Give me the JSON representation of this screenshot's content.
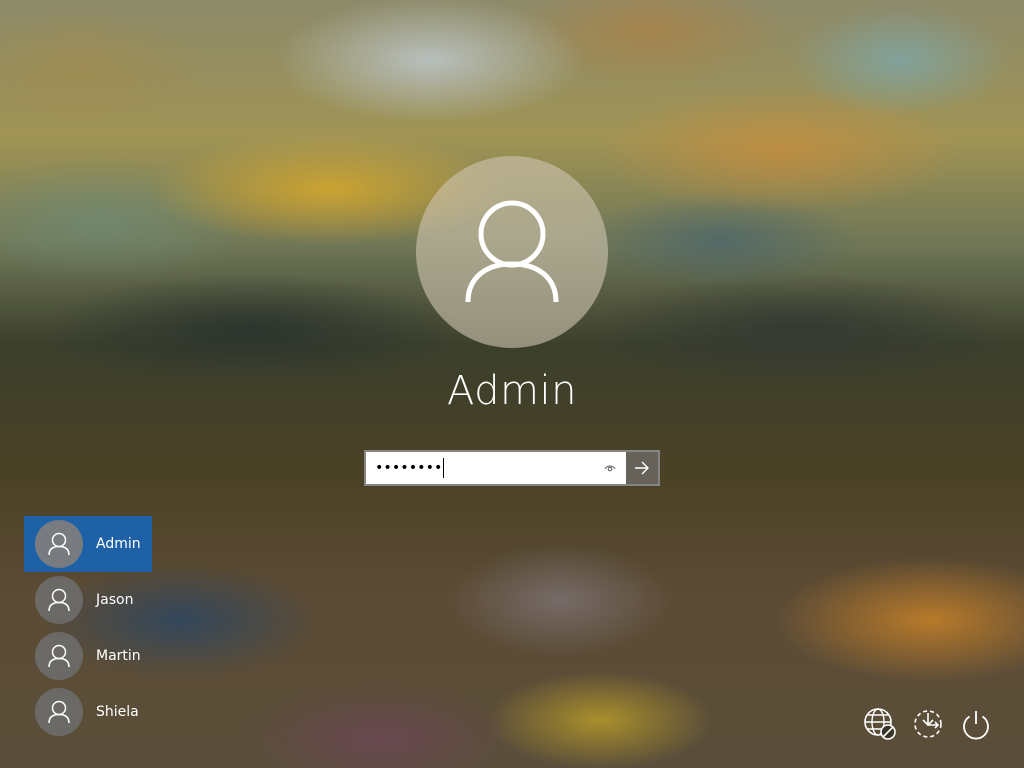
{
  "current_user": {
    "name": "Admin",
    "avatar_icon": "person-icon"
  },
  "password": {
    "masked_value": "••••••••",
    "reveal_icon": "eye-icon",
    "submit_icon": "arrow-right-icon"
  },
  "user_list": [
    {
      "name": "Admin",
      "avatar_icon": "person-icon",
      "selected": true
    },
    {
      "name": "Jason",
      "avatar_icon": "person-icon",
      "selected": false
    },
    {
      "name": "Martin",
      "avatar_icon": "person-icon",
      "selected": false
    },
    {
      "name": "Shiela",
      "avatar_icon": "person-icon",
      "selected": false
    }
  ],
  "system_icons": [
    "network-disconnected-icon",
    "ease-of-access-icon",
    "power-icon"
  ],
  "colors": {
    "selected_user": "#1f61a6",
    "text": "#ffffff",
    "submit_button": "#5f5a50"
  }
}
